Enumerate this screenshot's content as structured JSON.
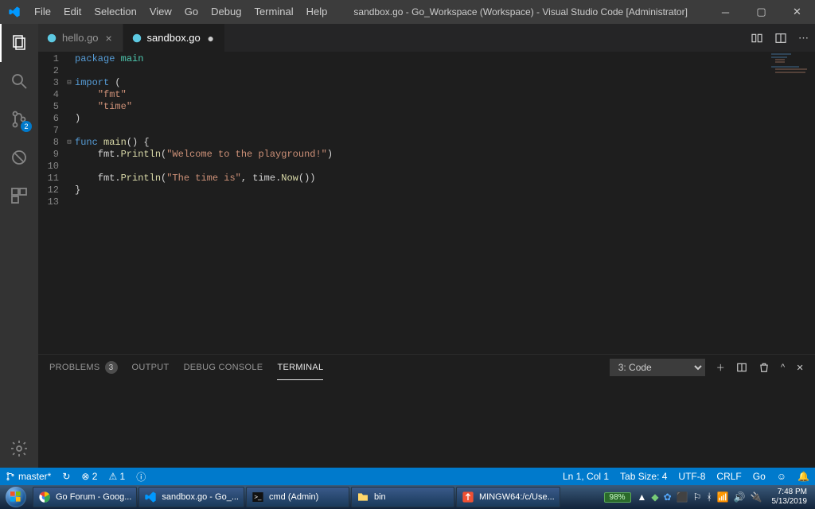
{
  "menu": [
    "File",
    "Edit",
    "Selection",
    "View",
    "Go",
    "Debug",
    "Terminal",
    "Help"
  ],
  "window_title": "sandbox.go - Go_Workspace (Workspace) - Visual Studio Code [Administrator]",
  "tabs": [
    {
      "label": "hello.go",
      "active": false,
      "dirty": false
    },
    {
      "label": "sandbox.go",
      "active": true,
      "dirty": true
    }
  ],
  "scm_badge": "2",
  "code_lines": [
    [
      {
        "c": "tok-k",
        "t": "package"
      },
      {
        "c": "tok-d",
        "t": " "
      },
      {
        "c": "tok-p",
        "t": "main"
      }
    ],
    [],
    [
      {
        "c": "tok-k",
        "t": "import"
      },
      {
        "c": "tok-d",
        "t": " ("
      }
    ],
    [
      {
        "c": "tok-d",
        "t": "    "
      },
      {
        "c": "tok-s",
        "t": "\"fmt\""
      }
    ],
    [
      {
        "c": "tok-d",
        "t": "    "
      },
      {
        "c": "tok-s",
        "t": "\"time\""
      }
    ],
    [
      {
        "c": "tok-d",
        "t": ")"
      }
    ],
    [],
    [
      {
        "c": "tok-k",
        "t": "func"
      },
      {
        "c": "tok-d",
        "t": " "
      },
      {
        "c": "tok-f",
        "t": "main"
      },
      {
        "c": "tok-d",
        "t": "() {"
      }
    ],
    [
      {
        "c": "tok-d",
        "t": "    fmt."
      },
      {
        "c": "tok-f",
        "t": "Println"
      },
      {
        "c": "tok-d",
        "t": "("
      },
      {
        "c": "tok-s",
        "t": "\"Welcome to the playground!\""
      },
      {
        "c": "tok-d",
        "t": ")"
      }
    ],
    [],
    [
      {
        "c": "tok-d",
        "t": "    fmt."
      },
      {
        "c": "tok-f",
        "t": "Println"
      },
      {
        "c": "tok-d",
        "t": "("
      },
      {
        "c": "tok-s",
        "t": "\"The time is\""
      },
      {
        "c": "tok-d",
        "t": ", time."
      },
      {
        "c": "tok-f",
        "t": "Now"
      },
      {
        "c": "tok-d",
        "t": "())"
      }
    ],
    [
      {
        "c": "tok-d",
        "t": "}"
      }
    ],
    []
  ],
  "fold_markers": {
    "3": "⊟",
    "8": "⊟"
  },
  "panel": {
    "tabs": [
      {
        "label": "PROBLEMS",
        "badge": "3"
      },
      {
        "label": "OUTPUT"
      },
      {
        "label": "DEBUG CONSOLE"
      },
      {
        "label": "TERMINAL",
        "active": true
      }
    ],
    "terminal_select": "3: Code"
  },
  "status": {
    "branch": "master*",
    "sync": "↻",
    "errors": "⊗ 2",
    "warnings": "⚠ 1",
    "info": "ⓘ",
    "position": "Ln 1, Col 1",
    "tab_size": "Tab Size: 4",
    "encoding": "UTF-8",
    "eol": "CRLF",
    "lang": "Go",
    "feedback": "☺",
    "bell": "🔔"
  },
  "taskbar": {
    "items": [
      {
        "icon": "chrome",
        "label": "Go Forum - Goog..."
      },
      {
        "icon": "vscode",
        "label": "sandbox.go - Go_..."
      },
      {
        "icon": "cmd",
        "label": "cmd (Admin)"
      },
      {
        "icon": "folder",
        "label": "bin"
      },
      {
        "icon": "git",
        "label": "MINGW64:/c/Use..."
      }
    ],
    "battery": "98%",
    "time": "7:48 PM",
    "date": "5/13/2019"
  }
}
